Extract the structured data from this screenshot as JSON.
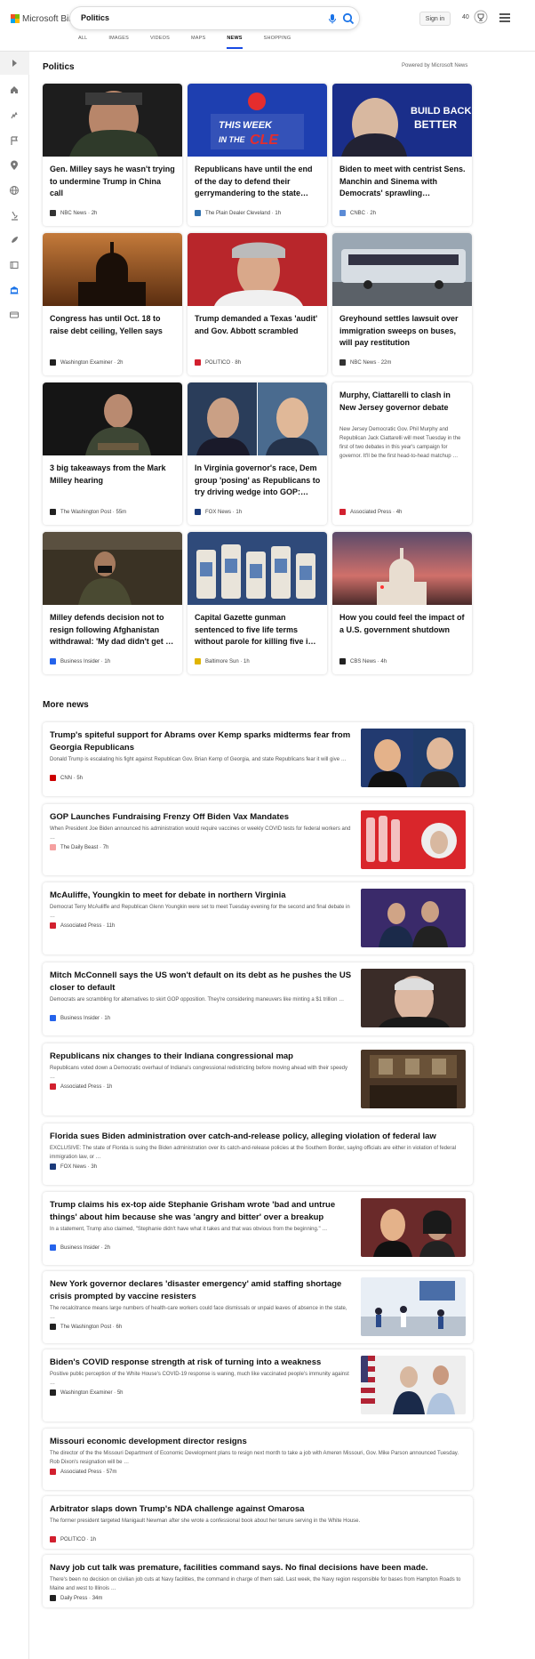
{
  "header": {
    "logo_text": "Microsoft Bing",
    "search_query": "Politics",
    "signin_label": "Sign in",
    "points": "40",
    "tabs": [
      "ALL",
      "IMAGES",
      "VIDEOS",
      "MAPS",
      "NEWS",
      "SHOPPING"
    ],
    "active_tab": "NEWS"
  },
  "sidebar": {
    "icons": [
      "expand-icon",
      "home-icon",
      "sparkle-icon",
      "flag-icon",
      "location-icon",
      "globe-icon",
      "microscope-icon",
      "rocket-icon",
      "film-icon",
      "bank-icon",
      "card-icon"
    ]
  },
  "section": {
    "title": "Politics",
    "powered": "Powered by Microsoft News"
  },
  "cards": [
    {
      "title": "Gen. Milley says he wasn't trying to undermine Trump in China call",
      "source": "NBC News",
      "time": "2h",
      "src_color": "#333"
    },
    {
      "title": "Republicans have until the end of the day to defend their gerrymandering to the state…",
      "source": "The Plain Dealer Cleveland",
      "time": "1h",
      "src_color": "#2f6fae"
    },
    {
      "title": "Biden to meet with centrist Sens. Manchin and Sinema with Democrats' sprawling…",
      "source": "CNBC",
      "time": "2h",
      "src_color": "#5b8bd6"
    },
    {
      "title": "Congress has until Oct. 18 to raise debt ceiling, Yellen says",
      "source": "Washington Examiner",
      "time": "2h",
      "src_color": "#222"
    },
    {
      "title": "Trump demanded a Texas 'audit' and Gov. Abbott scrambled",
      "source": "POLITICO",
      "time": "8h",
      "src_color": "#d2202f"
    },
    {
      "title": "Greyhound settles lawsuit over immigration sweeps on buses, will pay restitution",
      "source": "NBC News",
      "time": "22m",
      "src_color": "#333"
    },
    {
      "title": "3 big takeaways from the Mark Milley hearing",
      "source": "The Washington Post",
      "time": "55m",
      "src_color": "#222"
    },
    {
      "title": "In Virginia governor's race, Dem group 'posing' as Republicans to try driving wedge into GOP:…",
      "source": "FOX News",
      "time": "1h",
      "src_color": "#1b3a7a"
    },
    {
      "title": "Murphy, Ciattarelli to clash in New Jersey governor debate",
      "snippet": "New Jersey Democratic Gov. Phil Murphy and Republican Jack Ciattarelli will meet Tuesday in the first of two debates in this year's campaign for governor. It'll be the first head-to-head matchup …",
      "source": "Associated Press",
      "time": "4h",
      "src_color": "#d2202f"
    },
    {
      "title": "Milley defends decision not to resign following Afghanistan withdrawal: 'My dad didn't get …",
      "source": "Business Insider",
      "time": "1h",
      "src_color": "#2563eb"
    },
    {
      "title": "Capital Gazette gunman sentenced to five life terms without parole for killing five i…",
      "source": "Baltimore Sun",
      "time": "1h",
      "src_color": "#e0b400"
    },
    {
      "title": "How you could feel the impact of a U.S. government shutdown",
      "source": "CBS News",
      "time": "4h",
      "src_color": "#222"
    }
  ],
  "more_news": {
    "title": "More news",
    "items": [
      {
        "title": "Trump's spiteful support for Abrams over Kemp sparks midterms fear from Georgia Republicans",
        "snippet": "Donald Trump is escalating his fight against Republican Gov. Brian Kemp of Georgia, and state Republicans fear it will give …",
        "source": "CNN",
        "time": "5h",
        "src_color": "#cc0000"
      },
      {
        "title": "GOP Launches Fundraising Frenzy Off Biden Vax Mandates",
        "snippet": "When President Joe Biden announced his administration would require vaccines or weekly COVID tests for federal workers and …",
        "source": "The Daily Beast",
        "time": "7h",
        "src_color": "#f5a0a0"
      },
      {
        "title": "McAuliffe, Youngkin to meet for debate in northern Virginia",
        "snippet": "Democrat Terry McAuliffe and Republican Glenn Youngkin were set to meet Tuesday evening for the second and final debate in …",
        "source": "Associated Press",
        "time": "11h",
        "src_color": "#d2202f"
      },
      {
        "title": "Mitch McConnell says the US won't default on its debt as he pushes the US closer to default",
        "snippet": "Democrats are scrambling for alternatives to skirt GOP opposition. They're considering maneuvers like minting a $1 trillion …",
        "source": "Business Insider",
        "time": "1h",
        "src_color": "#2563eb"
      },
      {
        "title": "Republicans nix changes to their Indiana congressional map",
        "snippet": "Republicans voted down a Democratic overhaul of Indiana's congressional redistricting before moving ahead with their speedy …",
        "source": "Associated Press",
        "time": "1h",
        "src_color": "#d2202f"
      },
      {
        "title": "Florida sues Biden administration over catch-and-release policy, alleging violation of federal law",
        "snippet": "EXCLUSIVE: The state of Florida is suing the Biden administration over its catch-and-release policies at the Southern Border, saying officials are either in violation of federal immigration law, or …",
        "source": "FOX News",
        "time": "3h",
        "src_color": "#1b3a7a"
      },
      {
        "title": "Trump claims his ex-top aide Stephanie Grisham wrote 'bad and untrue things' about him because she was 'angry and bitter' over a breakup",
        "snippet": "In a statement, Trump also claimed, \"Stephanie didn't have what it takes and that was obvious from the beginning.\" …",
        "source": "Business Insider",
        "time": "2h",
        "src_color": "#2563eb"
      },
      {
        "title": "New York governor declares 'disaster emergency' amid staffing shortage crisis prompted by vaccine resisters",
        "snippet": "The recalcitrance means large numbers of health-care workers could face dismissals or unpaid leaves of absence in the state, …",
        "source": "The Washington Post",
        "time": "6h",
        "src_color": "#222"
      },
      {
        "title": "Biden's COVID response strength at risk of turning into a weakness",
        "snippet": "Positive public perception of the White House's COVID-19 response is waning, much like vaccinated people's immunity against …",
        "source": "Washington Examiner",
        "time": "5h",
        "src_color": "#222"
      },
      {
        "title": "Missouri economic development director resigns",
        "snippet": "The director of the the Missouri Department of Economic Development plans to resign next month to take a job with Ameren Missouri, Gov. Mike Parson announced Tuesday. Rob Dixon's resignation will be …",
        "source": "Associated Press",
        "time": "57m",
        "src_color": "#d2202f"
      },
      {
        "title": "Arbitrator slaps down Trump's NDA challenge against Omarosa",
        "snippet": "The former president targeted Manigault Newman after she wrote a confessional book about her tenure serving in the White House.",
        "source": "POLITICO",
        "time": "1h",
        "src_color": "#d2202f"
      },
      {
        "title": "Navy job cut talk was premature, facilities command says. No final decisions have been made.",
        "snippet": "There's been no decision on civilian job cuts at Navy facilities, the command in charge of them said. Last week, the Navy region responsible for bases from Hampton Roads to Maine and west to Illinois …",
        "source": "Daily Press",
        "time": "34m",
        "src_color": "#222"
      }
    ]
  },
  "thumb_labels": {
    "week_cle_1": "THIS",
    "week_cle_2": "WEEK",
    "week_cle_3": "IN THE",
    "week_cle_4": "CLE",
    "build_back": "BUILD BACK BETTER"
  }
}
